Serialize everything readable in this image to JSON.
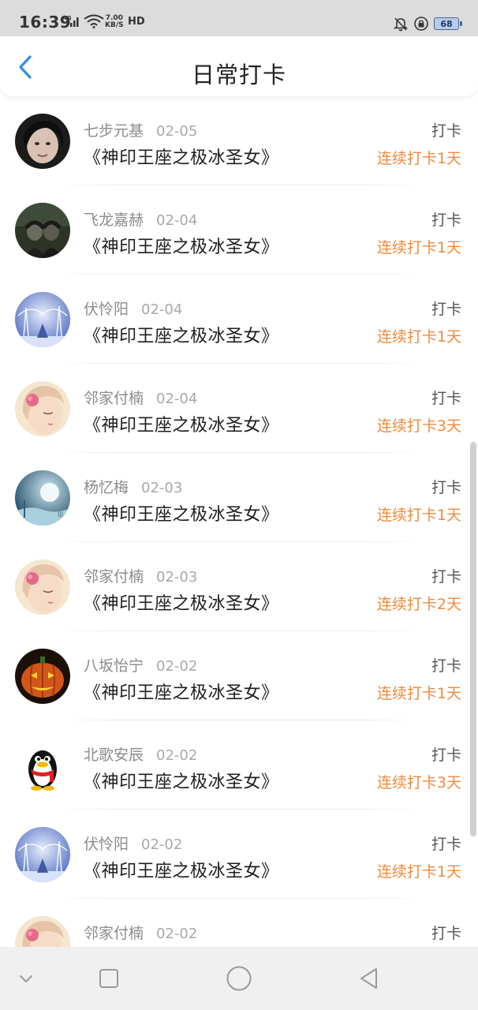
{
  "status_bar": {
    "time": "16:39",
    "network_label": "4G",
    "speed_value": "7.00",
    "speed_unit": "KB/S",
    "hd_label": "HD",
    "battery_level": "68"
  },
  "header": {
    "title": "日常打卡",
    "back_icon": "chevron-left-icon"
  },
  "accent_colors": {
    "back_arrow": "#2f8fe0",
    "streak_text": "#f08a3c"
  },
  "checkins": [
    {
      "user": "七步元基",
      "date": "02-05",
      "book": "《神印王座之极冰圣女》",
      "tag": "打卡",
      "streak": "连续打卡1天",
      "avatar": "portrait-dark-avatar"
    },
    {
      "user": "飞龙嘉赫",
      "date": "02-04",
      "book": "《神印王座之极冰圣女》",
      "tag": "打卡",
      "streak": "连续打卡1天",
      "avatar": "dark-photo-avatar"
    },
    {
      "user": "伏怜阳",
      "date": "02-04",
      "book": "《神印王座之极冰圣女》",
      "tag": "打卡",
      "streak": "连续打卡1天",
      "avatar": "snowy-trees-avatar"
    },
    {
      "user": "邻家付楠",
      "date": "02-04",
      "book": "《神印王座之极冰圣女》",
      "tag": "打卡",
      "streak": "连续打卡3天",
      "avatar": "anime-girl-avatar"
    },
    {
      "user": "杨忆梅",
      "date": "02-03",
      "book": "《神印王座之极冰圣女》",
      "tag": "打卡",
      "streak": "连续打卡1天",
      "avatar": "moon-scene-avatar"
    },
    {
      "user": "邻家付楠",
      "date": "02-03",
      "book": "《神印王座之极冰圣女》",
      "tag": "打卡",
      "streak": "连续打卡2天",
      "avatar": "anime-girl-avatar"
    },
    {
      "user": "八坂怡宁",
      "date": "02-02",
      "book": "《神印王座之极冰圣女》",
      "tag": "打卡",
      "streak": "连续打卡1天",
      "avatar": "pumpkin-avatar"
    },
    {
      "user": "北歌安辰",
      "date": "02-02",
      "book": "《神印王座之极冰圣女》",
      "tag": "打卡",
      "streak": "连续打卡3天",
      "avatar": "penguin-avatar"
    },
    {
      "user": "伏怜阳",
      "date": "02-02",
      "book": "《神印王座之极冰圣女》",
      "tag": "打卡",
      "streak": "连续打卡1天",
      "avatar": "snowy-trees-avatar"
    },
    {
      "user": "邻家付楠",
      "date": "02-02",
      "book": "",
      "tag": "打卡",
      "streak": "",
      "avatar": "anime-girl-avatar"
    }
  ],
  "nav_bar": {
    "buttons": [
      "chevron-down-icon",
      "square-recents-icon",
      "circle-home-icon",
      "triangle-back-icon"
    ]
  }
}
